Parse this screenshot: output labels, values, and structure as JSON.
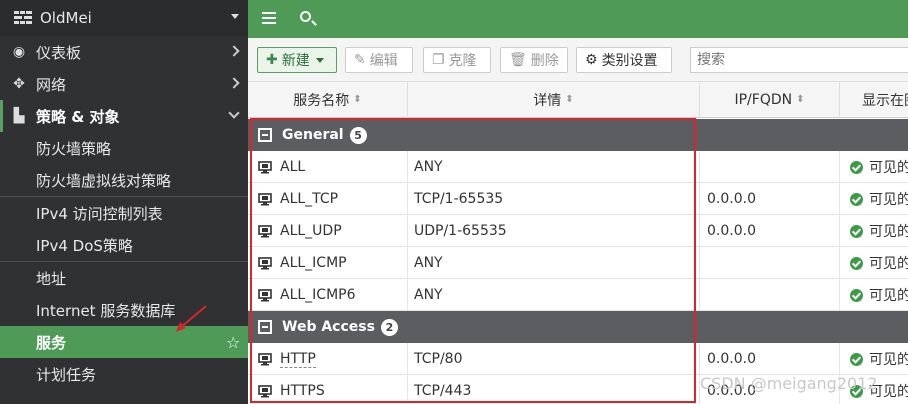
{
  "app": {
    "device_name": "OldMei"
  },
  "sidebar": {
    "items": [
      {
        "label": "仪表板",
        "icon": "dashboard-icon"
      },
      {
        "label": "网络",
        "icon": "move-icon"
      },
      {
        "label": "策略 & 对象",
        "icon": "policy-icon"
      },
      {
        "label": "防火墙策略"
      },
      {
        "label": "防火墙虚拟线对策略"
      },
      {
        "label": "IPv4 访问控制列表"
      },
      {
        "label": "IPv4 DoS策略"
      },
      {
        "label": "地址"
      },
      {
        "label": "Internet 服务数据库"
      },
      {
        "label": "服务"
      },
      {
        "label": "计划任务"
      }
    ]
  },
  "toolbar": {
    "new_label": "新建",
    "edit_label": "编辑",
    "clone_label": "克隆",
    "delete_label": "删除",
    "category_label": "类别设置",
    "search_placeholder": "搜索"
  },
  "table": {
    "columns": [
      "服务名称",
      "详情",
      "IP/FQDN",
      "显示在图"
    ],
    "groups": [
      {
        "name": "General",
        "count": "5",
        "rows": [
          {
            "name": "ALL",
            "details": "ANY",
            "ip": "",
            "visible": "可见的"
          },
          {
            "name": "ALL_TCP",
            "details": "TCP/1-65535",
            "ip": "0.0.0.0",
            "visible": "可见的"
          },
          {
            "name": "ALL_UDP",
            "details": "UDP/1-65535",
            "ip": "0.0.0.0",
            "visible": "可见的"
          },
          {
            "name": "ALL_ICMP",
            "details": "ANY",
            "ip": "",
            "visible": "可见的"
          },
          {
            "name": "ALL_ICMP6",
            "details": "ANY",
            "ip": "",
            "visible": "可见的"
          }
        ]
      },
      {
        "name": "Web Access",
        "count": "2",
        "rows": [
          {
            "name": "HTTP",
            "details": "TCP/80",
            "ip": "0.0.0.0",
            "visible": "可见的"
          },
          {
            "name": "HTTPS",
            "details": "TCP/443",
            "ip": "0.0.0.0",
            "visible": "可见的"
          }
        ]
      }
    ]
  },
  "watermark": "CSDN @meigang2012",
  "colors": {
    "brand_green": "#4e9a56",
    "sidebar_bg": "#2f3133",
    "highlight_red": "#d9262a",
    "group_header_bg": "#5b5d60"
  }
}
